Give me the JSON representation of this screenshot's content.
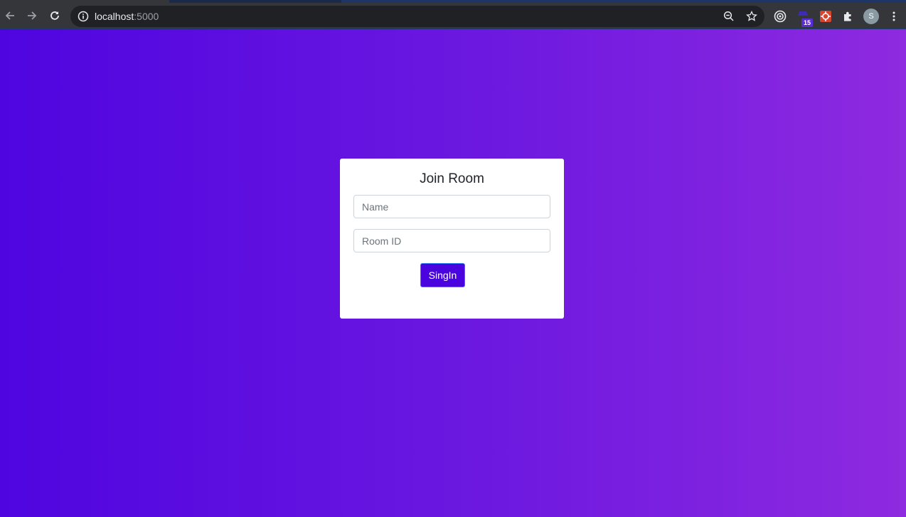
{
  "browser": {
    "url_host": "localhost",
    "url_port": ":5000",
    "extension_badge": "15",
    "profile_initial": "S",
    "icons": [
      "back-icon",
      "forward-icon",
      "reload-icon",
      "info-icon",
      "zoom-out-icon",
      "star-icon",
      "extension-target-icon",
      "extension-badge-icon",
      "extension-red-icon",
      "puzzle-icon",
      "kebab-menu-icon"
    ]
  },
  "colors": {
    "gradient_start": "#4f05e0",
    "gradient_end": "#8e2ae0",
    "button_bg": "#4a05de",
    "card_bg": "#ffffff"
  },
  "form": {
    "title": "Join Room",
    "name_placeholder": "Name",
    "name_value": "",
    "room_placeholder": "Room ID",
    "room_value": "",
    "submit_label": "SingIn"
  }
}
